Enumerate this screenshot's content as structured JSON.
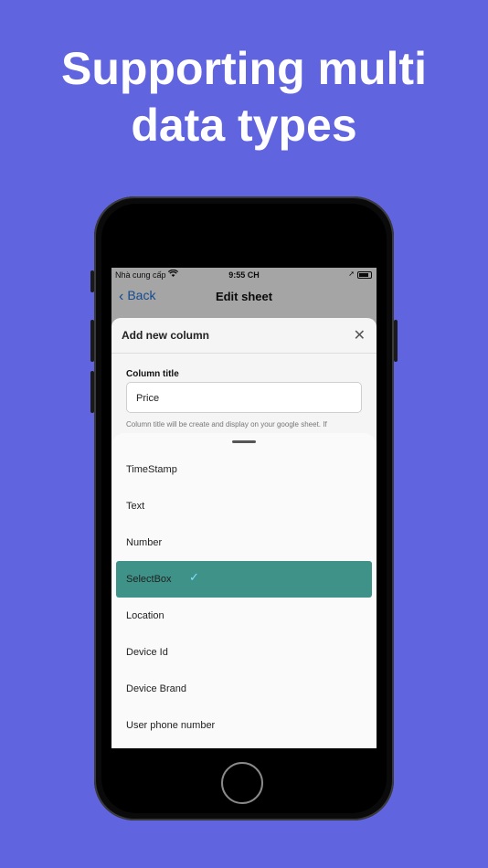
{
  "headline": {
    "line1": "Supporting multi",
    "line2": "data types"
  },
  "status_bar": {
    "carrier": "Nhà cung cấp",
    "time": "9:55 CH"
  },
  "nav": {
    "back_label": "Back",
    "title": "Edit sheet"
  },
  "modal": {
    "title": "Add new column",
    "field_label": "Column title",
    "field_value": "Price",
    "help_text": "Column title will be create and display on your google sheet. If"
  },
  "sheet": {
    "options": [
      {
        "label": "TimeStamp",
        "selected": false
      },
      {
        "label": "Text",
        "selected": false
      },
      {
        "label": "Number",
        "selected": false
      },
      {
        "label": "SelectBox",
        "selected": true
      },
      {
        "label": "Location",
        "selected": false
      },
      {
        "label": "Device Id",
        "selected": false
      },
      {
        "label": "Device Brand",
        "selected": false
      },
      {
        "label": "User phone number",
        "selected": false
      }
    ]
  },
  "colors": {
    "background": "#6064de",
    "selected": "#3f9288",
    "accent_blue": "#1f6fd6"
  }
}
